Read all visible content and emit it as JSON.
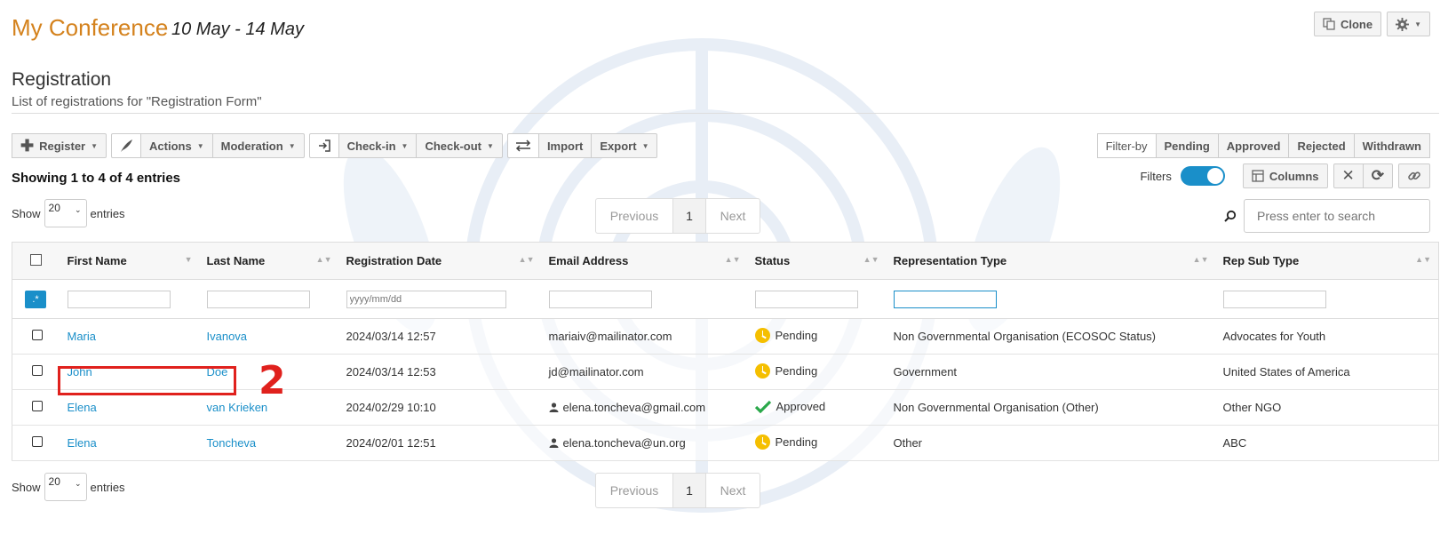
{
  "header": {
    "title": "My Conference",
    "dates": "10 May - 14 May",
    "clone_label": "Clone"
  },
  "section": {
    "title": "Registration",
    "subtitle": "List of registrations for \"Registration Form\""
  },
  "toolbar": {
    "register": "Register",
    "actions": "Actions",
    "moderation": "Moderation",
    "checkin": "Check-in",
    "checkout": "Check-out",
    "import": "Import",
    "export": "Export",
    "filter_by": "Filter-by",
    "filters": [
      "Pending",
      "Approved",
      "Rejected",
      "Withdrawn"
    ]
  },
  "info": {
    "showing": "Showing 1 to 4 of 4 entries",
    "filters_label": "Filters",
    "columns_label": "Columns"
  },
  "length": {
    "show": "Show",
    "value": "20",
    "entries": "entries"
  },
  "pager": {
    "previous": "Previous",
    "page": "1",
    "next": "Next"
  },
  "search": {
    "placeholder": "Press enter to search"
  },
  "table": {
    "headers": [
      "First Name",
      "Last Name",
      "Registration Date",
      "Email Address",
      "Status",
      "Representation Type",
      "Rep Sub Type"
    ],
    "regex_label": ".*",
    "date_placeholder": "yyyy/mm/dd",
    "rows": [
      {
        "first": "Maria",
        "last": "Ivanova",
        "date": "2024/03/14 12:57",
        "email": "mariaiv@mailinator.com",
        "status": "Pending",
        "rep": "Non Governmental Organisation (ECOSOC Status)",
        "sub": "Advocates for Youth"
      },
      {
        "first": "John",
        "last": "Doe",
        "date": "2024/03/14 12:53",
        "email": "jd@mailinator.com",
        "status": "Pending",
        "rep": "Government",
        "sub": "United States of America"
      },
      {
        "first": "Elena",
        "last": "van Krieken",
        "date": "2024/02/29 10:10",
        "email": "elena.toncheva@gmail.com",
        "status": "Approved",
        "rep": "Non Governmental Organisation (Other)",
        "sub": "Other NGO"
      },
      {
        "first": "Elena",
        "last": "Toncheva",
        "date": "2024/02/01 12:51",
        "email": "elena.toncheva@un.org",
        "status": "Pending",
        "rep": "Other",
        "sub": "ABC"
      }
    ]
  },
  "annotation": {
    "number": "2",
    "color": "#e0211d"
  },
  "colors": {
    "accent": "#1a8fc9",
    "title": "#d4821d",
    "pending": "#f5bf00",
    "approved": "#2aa84a"
  }
}
